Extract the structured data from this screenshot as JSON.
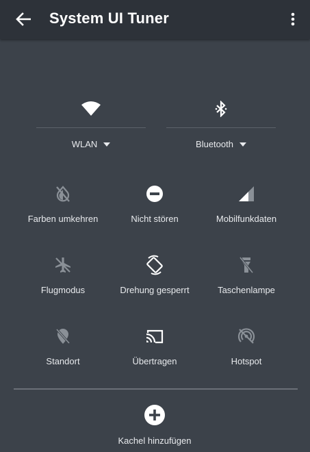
{
  "app_bar": {
    "title": "System UI Tuner",
    "back_icon": "arrow-back-icon",
    "menu_icon": "more-vert-icon"
  },
  "colors": {
    "app_bar_bg": "#2d3239",
    "panel_bg": "#3c424a",
    "active_icon": "#ffffff",
    "inactive_icon": "#8a9097"
  },
  "big_tiles": [
    {
      "label": "WLAN",
      "icon": "wifi-icon",
      "state": "active"
    },
    {
      "label": "Bluetooth",
      "icon": "bluetooth-icon",
      "state": "active"
    }
  ],
  "tiles": [
    {
      "label": "Farben umkehren",
      "icon": "invert-colors-off-icon",
      "state": "inactive"
    },
    {
      "label": "Nicht stören",
      "icon": "do-not-disturb-icon",
      "state": "active"
    },
    {
      "label": "Mobilfunkdaten",
      "icon": "signal-cellular-icon",
      "state": "active"
    },
    {
      "label": "Flugmodus",
      "icon": "airplane-icon",
      "state": "inactive"
    },
    {
      "label": "Drehung gesperrt",
      "icon": "screen-rotation-icon",
      "state": "active"
    },
    {
      "label": "Taschenlampe",
      "icon": "flashlight-off-icon",
      "state": "inactive"
    },
    {
      "label": "Standort",
      "icon": "location-off-icon",
      "state": "inactive"
    },
    {
      "label": "Übertragen",
      "icon": "cast-icon",
      "state": "active"
    },
    {
      "label": "Hotspot",
      "icon": "hotspot-off-icon",
      "state": "inactive"
    }
  ],
  "add_tile": {
    "label": "Kachel hinzufügen",
    "icon": "add-circle-icon"
  }
}
